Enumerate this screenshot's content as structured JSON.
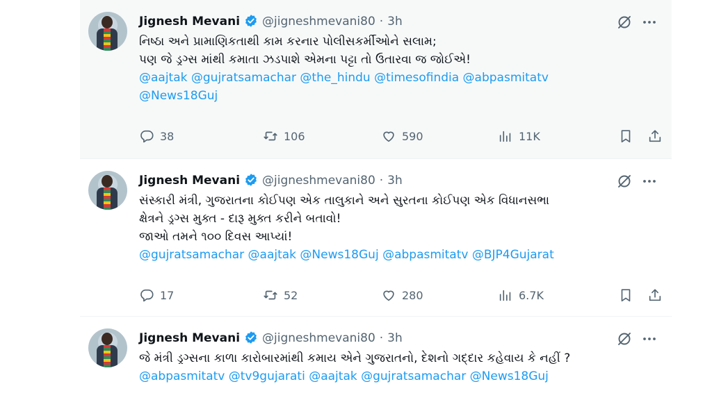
{
  "tweets": [
    {
      "author": "Jignesh Mevani",
      "handle": "@jigneshmevani80",
      "dot": "·",
      "time": "3h",
      "lines": [
        "નિષ્ઠા અને પ્રામાણિકતાથી કામ કરનાર પોલીસકર્મીઓને સલામ;",
        "પણ જે ડ્રગ્સ માંથી કમાતા ઝડપાશે એમના પટ્ટા તો ઉતારવા જ જોઈએ!"
      ],
      "mentions": [
        "@aajtak @gujratsamachar @the_hindu @timesofindia @abpasmitatv",
        "@News18Guj"
      ],
      "stats": {
        "replies": "38",
        "retweets": "106",
        "likes": "590",
        "views": "11K"
      }
    },
    {
      "author": "Jignesh Mevani",
      "handle": "@jigneshmevani80",
      "dot": "·",
      "time": "3h",
      "lines": [
        "સંસ્કારી મંત્રી, ગુજરાતના કોઈપણ એક તાલુકાને અને સુરતના કોઈપણ એક વિધાનસભા",
        "ક્ષેત્રને ડ્રગ્સ મુક્ત - દારૂ મુક્ત કરીને બતાવો!",
        "જાઓ તમને ૧૦૦ દિવસ આપ્યાં!"
      ],
      "mentions": [
        "@gujratsamachar @aajtak @News18Guj @abpasmitatv @BJP4Gujarat"
      ],
      "stats": {
        "replies": "17",
        "retweets": "52",
        "likes": "280",
        "views": "6.7K"
      }
    },
    {
      "author": "Jignesh Mevani",
      "handle": "@jigneshmevani80",
      "dot": "·",
      "time": "3h",
      "lines": [
        "જે મંત્રી ડ્રગ્સના કાળા કારોબારમાંથી કમાય એને ગુજરાતનો, દેશનો ગદ્દાર કહેવાય કે નહીં ?"
      ],
      "mentions": [
        "@abpasmitatv @tv9gujarati @aajtak @gujratsamachar @News18Guj"
      ]
    }
  ],
  "icons": {
    "verified": "verified-badge-icon",
    "grok": "grok-icon",
    "more": "more-icon",
    "reply": "reply-icon",
    "retweet": "retweet-icon",
    "like": "heart-icon",
    "views": "views-icon",
    "bookmark": "bookmark-icon",
    "share": "share-icon"
  },
  "colors": {
    "link": "#1d9bf0",
    "secondary": "#536471",
    "verified": "#1d9bf0",
    "highlight_bg": "#f7f9f9"
  }
}
